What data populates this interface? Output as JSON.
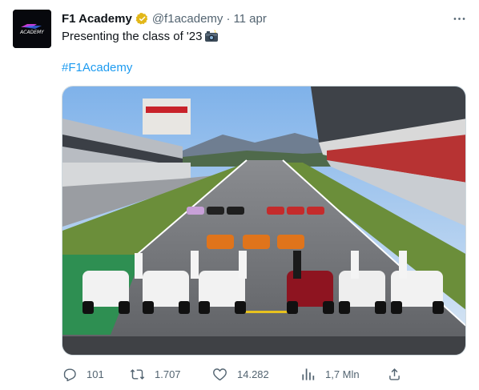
{
  "tweet": {
    "author": {
      "name": "F1 Academy",
      "handle": "@f1academy",
      "verified_badge_color": "#e2b719",
      "avatar_logo_text": "ACADEMY"
    },
    "separator": "·",
    "date": "11 apr",
    "text": "Presenting the class of '23",
    "text_icon": "camera-flash-icon",
    "hashtag": "#F1Academy",
    "image": {
      "description_icon": "race-car-grid-photo"
    },
    "actions": {
      "reply_count": "101",
      "retweet_count": "1.707",
      "like_count": "14.282",
      "views_count": "1,7 Mln"
    }
  },
  "colors": {
    "text_primary": "#0f1419",
    "text_secondary": "#536471",
    "link": "#1d9bf0"
  }
}
